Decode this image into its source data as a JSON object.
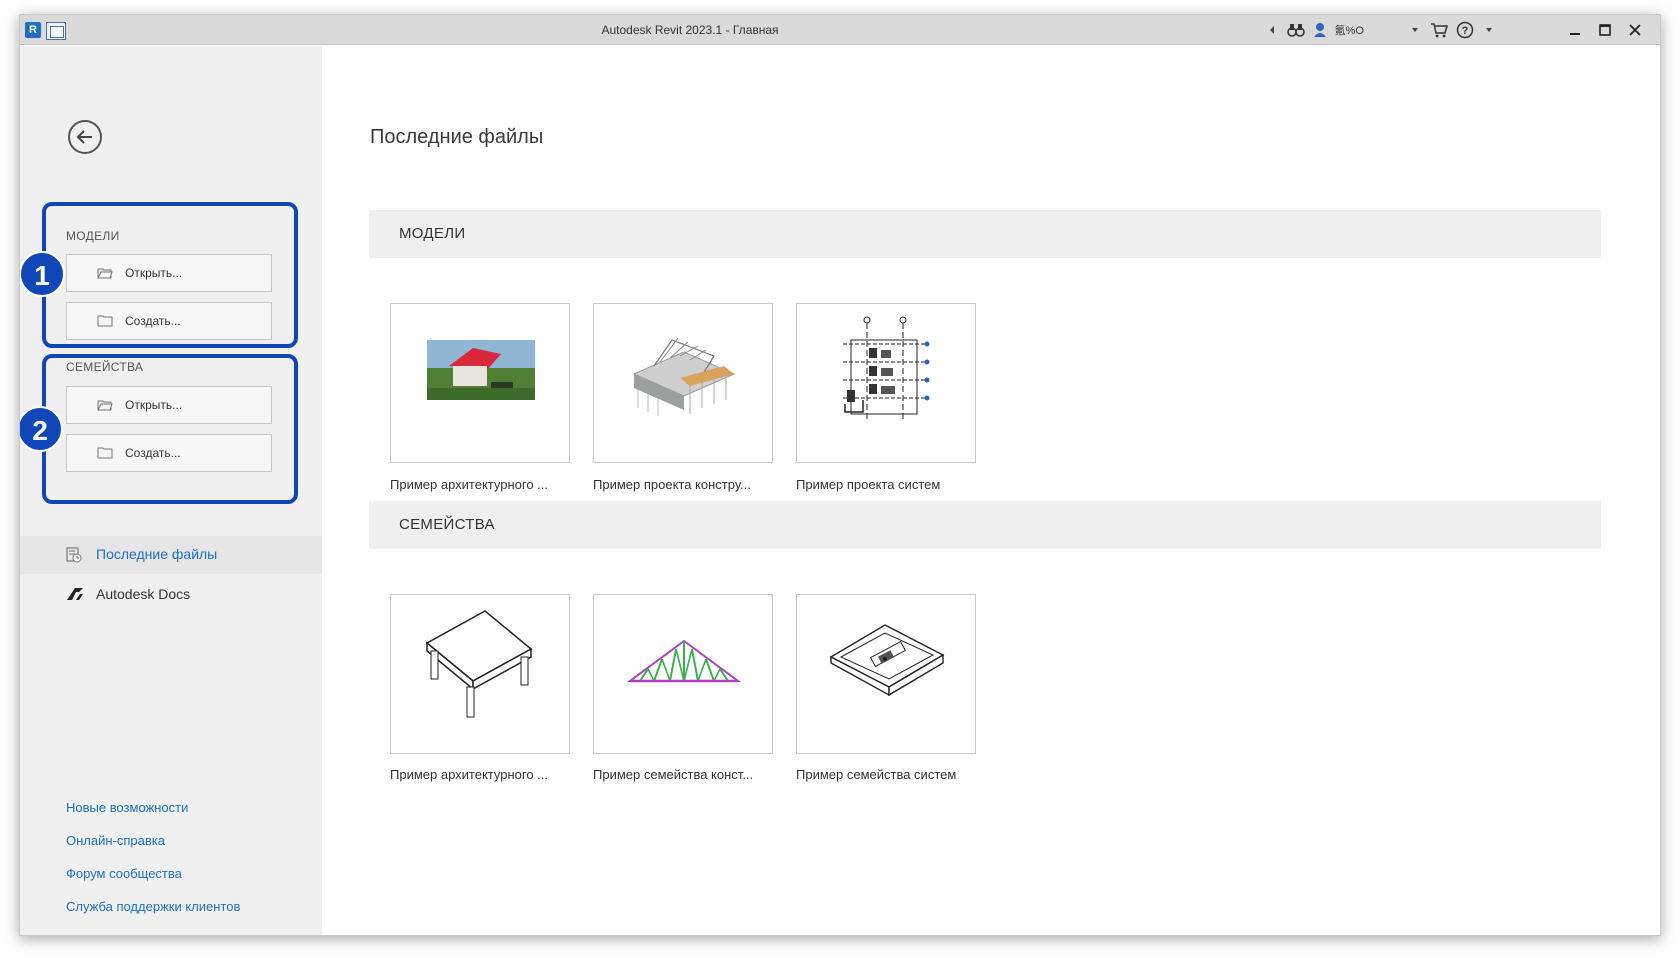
{
  "window": {
    "title": "Autodesk Revit 2023.1 - Главная",
    "user_name": "氪%O"
  },
  "colors": {
    "accent_link": "#1d6fc1",
    "callout": "#0f46b8",
    "sidebar_bg": "#f0f0f0"
  },
  "sidebar": {
    "models": {
      "title": "МОДЕЛИ",
      "open_label": "Открыть...",
      "create_label": "Создать..."
    },
    "families": {
      "title": "СЕМЕЙСТВА",
      "open_label": "Открыть...",
      "create_label": "Создать..."
    },
    "callouts": [
      "1",
      "2"
    ],
    "nav": [
      {
        "label": "Последние файлы",
        "icon": "recent-files-icon",
        "active": true
      },
      {
        "label": "Autodesk Docs",
        "icon": "autodesk-docs-icon",
        "active": false
      }
    ],
    "links": [
      "Новые возможности",
      "Онлайн-справка",
      "Форум сообщества",
      "Служба поддержки клиентов"
    ]
  },
  "main": {
    "title": "Последние файлы",
    "models_section": {
      "title": "МОДЕЛИ",
      "items": [
        {
          "label": "Пример архитектурного ...",
          "thumb": "architectural-model-thumbnail"
        },
        {
          "label": "Пример проекта констру...",
          "thumb": "structural-model-thumbnail"
        },
        {
          "label": "Пример проекта систем",
          "thumb": "systems-model-thumbnail"
        }
      ]
    },
    "families_section": {
      "title": "СЕМЕЙСТВА",
      "items": [
        {
          "label": "Пример архитектурного ...",
          "thumb": "table-family-thumbnail"
        },
        {
          "label": "Пример семейства конст...",
          "thumb": "truss-family-thumbnail"
        },
        {
          "label": "Пример семейства систем",
          "thumb": "systems-family-thumbnail"
        }
      ]
    }
  }
}
